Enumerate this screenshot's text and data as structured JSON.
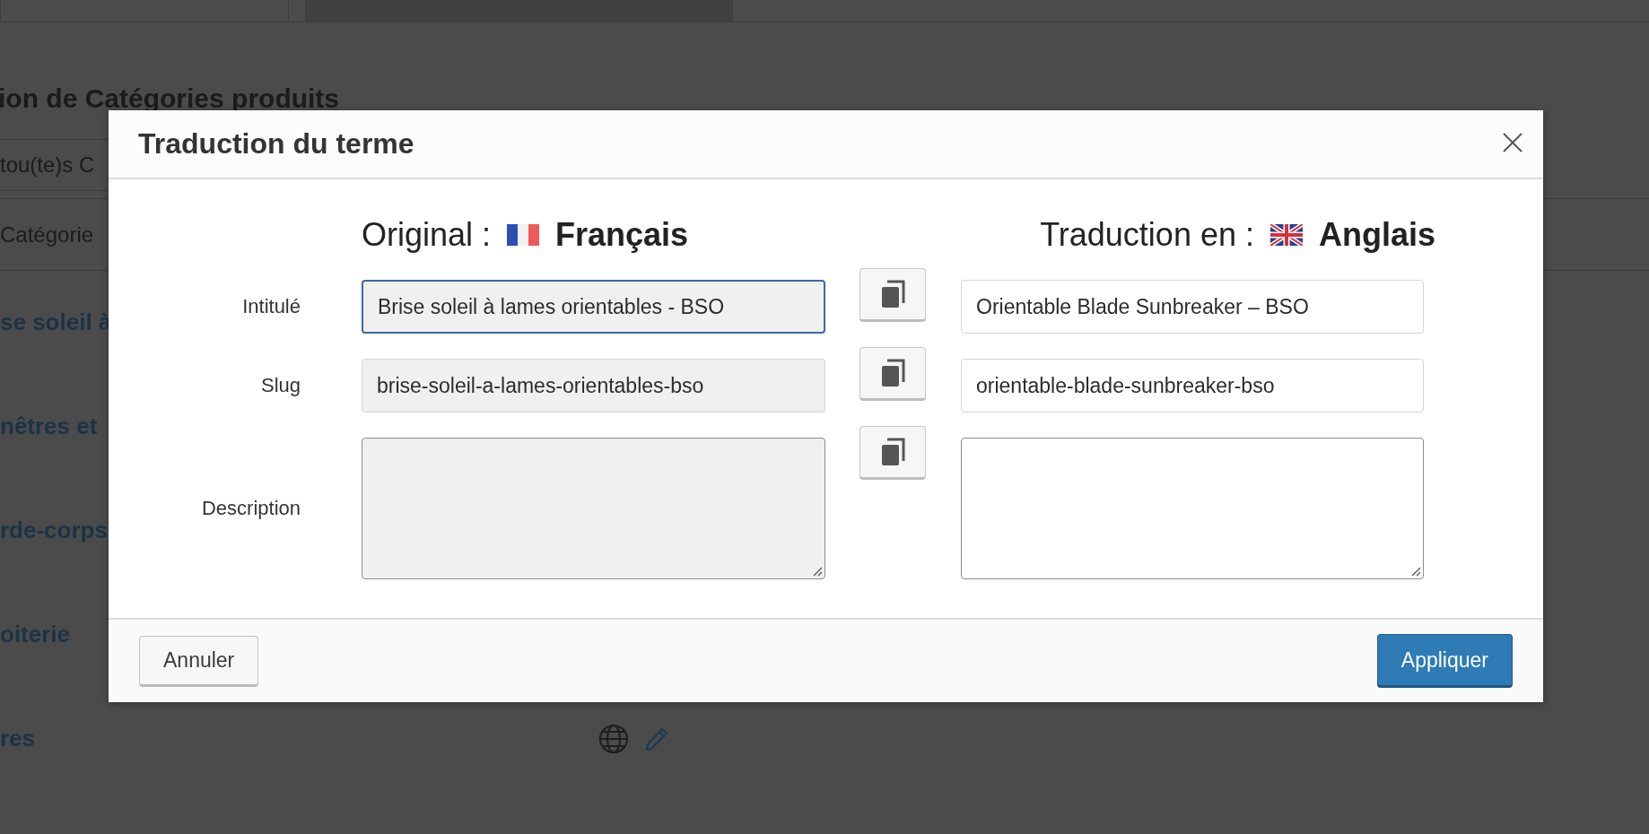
{
  "background_page": {
    "tabs": [
      {
        "selected": true
      },
      {
        "selected": false
      }
    ],
    "heading": "ion de Catégories produits",
    "filter": "tou(te)s C",
    "column_header": "Catégorie",
    "rows": [
      {
        "name": "se soleil à"
      },
      {
        "name": "nêtres et"
      },
      {
        "name": "rde-corps"
      },
      {
        "name": "oiterie"
      },
      {
        "name": "res",
        "actions": true
      }
    ]
  },
  "dialog": {
    "title": "Traduction du terme",
    "original": {
      "label": "Original :",
      "language": "Français",
      "kind": "fr"
    },
    "translation": {
      "label": "Traduction en :",
      "language": "Anglais",
      "kind": "gb"
    },
    "fields": [
      {
        "label": "Intitulé",
        "kind": "input",
        "original": "Brise soleil à lames orientables - BSO",
        "translation": "Orientable Blade Sunbreaker – BSO",
        "focused": true
      },
      {
        "label": "Slug",
        "kind": "input",
        "original": "brise-soleil-a-lames-orientables-bso",
        "translation": "orientable-blade-sunbreaker-bso",
        "focused": false
      },
      {
        "label": "Description",
        "kind": "textarea",
        "focused": false
      }
    ],
    "buttons": [
      {
        "label": "Annuler",
        "kind": "secondary"
      },
      {
        "label": "Appliquer",
        "kind": "primary"
      }
    ]
  }
}
